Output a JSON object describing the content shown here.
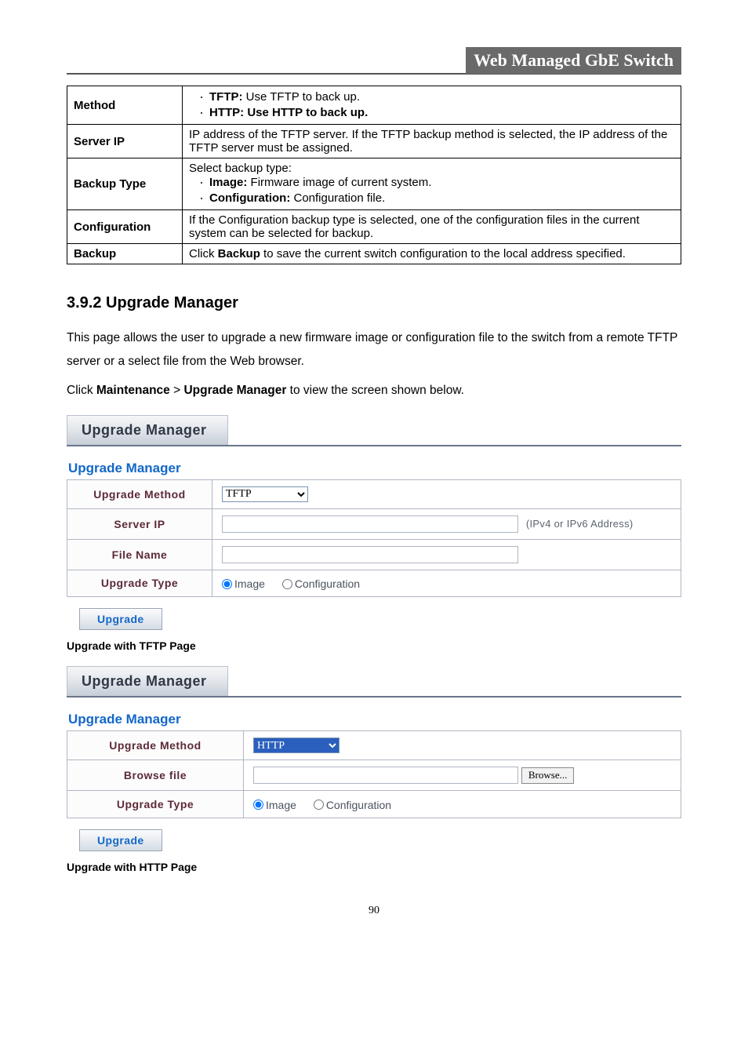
{
  "header": {
    "title": "Web Managed GbE Switch"
  },
  "defs": {
    "rows": [
      {
        "label": "Method",
        "type": "list",
        "items": [
          {
            "b": "TFTP:",
            "t": " Use TFTP to back up."
          },
          {
            "b": "HTTP:",
            "t": " Use HTTP to back up."
          }
        ]
      },
      {
        "label": "Server IP",
        "type": "text",
        "text": "IP address of the TFTP server. If the TFTP backup method is selected, the IP address of the TFTP server must be assigned."
      },
      {
        "label": "Backup Type",
        "type": "leadlist",
        "lead": "Select backup type:",
        "items": [
          {
            "b": "Image:",
            "t": " Firmware image of current system."
          },
          {
            "b": "Configuration:",
            "t": " Configuration file."
          }
        ]
      },
      {
        "label": "Configuration",
        "type": "text",
        "text": "If the Configuration backup type is selected, one of the configuration files in the current system can be selected for backup."
      },
      {
        "label": "Backup",
        "type": "bspan",
        "pre": "Click ",
        "b": "Backup",
        "post": " to save the current switch configuration to the local address specified."
      }
    ]
  },
  "section": {
    "heading": "3.9.2 Upgrade Manager",
    "p1": "This page allows the user to upgrade a new firmware image or configuration file to the switch from a remote TFTP server or a select file from the Web browser.",
    "p2_pre": "Click ",
    "p2_b1": "Maintenance",
    "p2_mid": " > ",
    "p2_b2": "Upgrade Manager",
    "p2_post": " to view the screen shown below."
  },
  "panels": {
    "tab_label": "Upgrade Manager",
    "form_title": "Upgrade Manager",
    "tftp": {
      "method_label": "Upgrade Method",
      "method_value": "TFTP",
      "server_label": "Server IP",
      "server_hint": "(IPv4 or IPv6 Address)",
      "file_label": "File Name",
      "type_label": "Upgrade Type",
      "radio_image": "Image",
      "radio_config": "Configuration",
      "button": "Upgrade",
      "caption": "Upgrade with TFTP Page"
    },
    "http": {
      "method_label": "Upgrade Method",
      "method_value": "HTTP",
      "browse_label": "Browse file",
      "browse_btn": "Browse...",
      "type_label": "Upgrade Type",
      "radio_image": "Image",
      "radio_config": "Configuration",
      "button": "Upgrade",
      "caption": "Upgrade with HTTP Page"
    }
  },
  "page_number": "90"
}
